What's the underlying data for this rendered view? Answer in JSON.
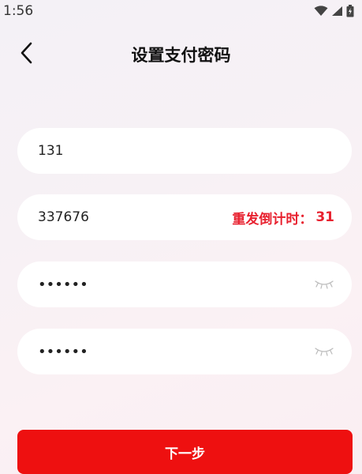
{
  "status_bar": {
    "time": "1:56"
  },
  "header": {
    "title": "设置支付密码",
    "back_icon": "chevron-left-icon"
  },
  "form": {
    "phone_value": "131",
    "code_value": "337676",
    "countdown_label": "重发倒计时：",
    "countdown_seconds": "31",
    "password_mask": "••••••",
    "confirm_password_mask": "••••••",
    "eye_icon": "eye-closed-icon"
  },
  "next_button": {
    "label": "下一步"
  },
  "colors": {
    "accent": "#ee1010",
    "countdown": "#e8212f"
  }
}
